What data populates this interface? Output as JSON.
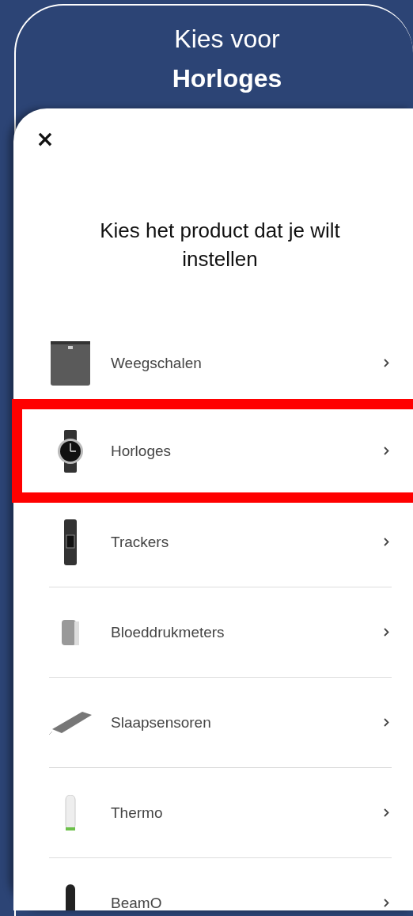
{
  "header": {
    "prefix": "Kies voor",
    "product": "Horloges"
  },
  "dialog": {
    "close": "×",
    "heading": "Kies het product dat je wilt instellen",
    "items": [
      {
        "label": "Weegschalen",
        "kind": "scale",
        "selected": false
      },
      {
        "label": "Horloges",
        "kind": "watch",
        "selected": true
      },
      {
        "label": "Trackers",
        "kind": "tracker",
        "selected": false
      },
      {
        "label": "Bloeddrukmeters",
        "kind": "cuff",
        "selected": false
      },
      {
        "label": "Slaapsensoren",
        "kind": "mat",
        "selected": false
      },
      {
        "label": "Thermo",
        "kind": "thermometer",
        "selected": false
      },
      {
        "label": "BeamO",
        "kind": "scanner",
        "selected": false
      }
    ]
  }
}
